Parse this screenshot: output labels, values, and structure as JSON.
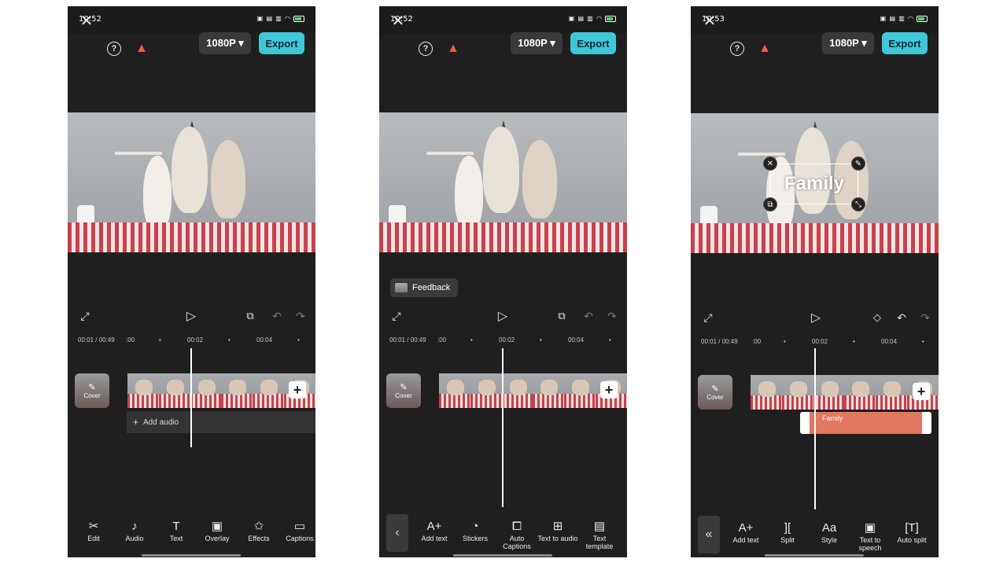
{
  "screens": [
    {
      "time": "10:52",
      "resolution": "1080P ▾",
      "export": "Export",
      "ruler": [
        "00:01 / 00:49",
        ":00",
        "•",
        "00:02",
        "•",
        "00:04",
        "•"
      ],
      "cover": "Cover",
      "add_audio": "Add audio",
      "tools": [
        {
          "icon": "scissors-icon",
          "label": "Edit"
        },
        {
          "icon": "music-note-icon",
          "label": "Audio"
        },
        {
          "icon": "text-icon",
          "label": "Text"
        },
        {
          "icon": "overlay-icon",
          "label": "Overlay"
        },
        {
          "icon": "effects-icon",
          "label": "Effects"
        },
        {
          "icon": "captions-icon",
          "label": "Captions"
        }
      ]
    },
    {
      "time": "10:52",
      "resolution": "1080P ▾",
      "export": "Export",
      "feedback": "Feedback",
      "ruler": [
        "00:01 / 00:49",
        ":00",
        "•",
        "00:02",
        "•",
        "00:04",
        "•"
      ],
      "cover": "Cover",
      "tools": [
        {
          "icon": "add-text-icon",
          "label": "Add text"
        },
        {
          "icon": "stickers-icon",
          "label": "Stickers"
        },
        {
          "icon": "auto-captions-icon",
          "label": "Auto Captions"
        },
        {
          "icon": "text-to-audio-icon",
          "label": "Text to audio"
        },
        {
          "icon": "text-template-icon",
          "label": "Text template"
        }
      ]
    },
    {
      "time": "10:53",
      "resolution": "1080P ▾",
      "export": "Export",
      "overlay_text": "Family",
      "clip_text": "Family",
      "ruler": [
        "00:01 / 00:49",
        ":00",
        "•",
        "00:02",
        "•",
        "00:04",
        "•"
      ],
      "cover": "Cover",
      "tools": [
        {
          "icon": "add-text-icon",
          "label": "Add text"
        },
        {
          "icon": "split-icon",
          "label": "Split"
        },
        {
          "icon": "style-icon",
          "label": "Style"
        },
        {
          "icon": "text-to-speech-icon",
          "label": "Text to speech"
        },
        {
          "icon": "auto-split-icon",
          "label": "Auto split"
        }
      ]
    }
  ],
  "colors": {
    "accent": "#3fc7d9",
    "text_clip": "#e27762",
    "flame": "#f05a4a"
  }
}
